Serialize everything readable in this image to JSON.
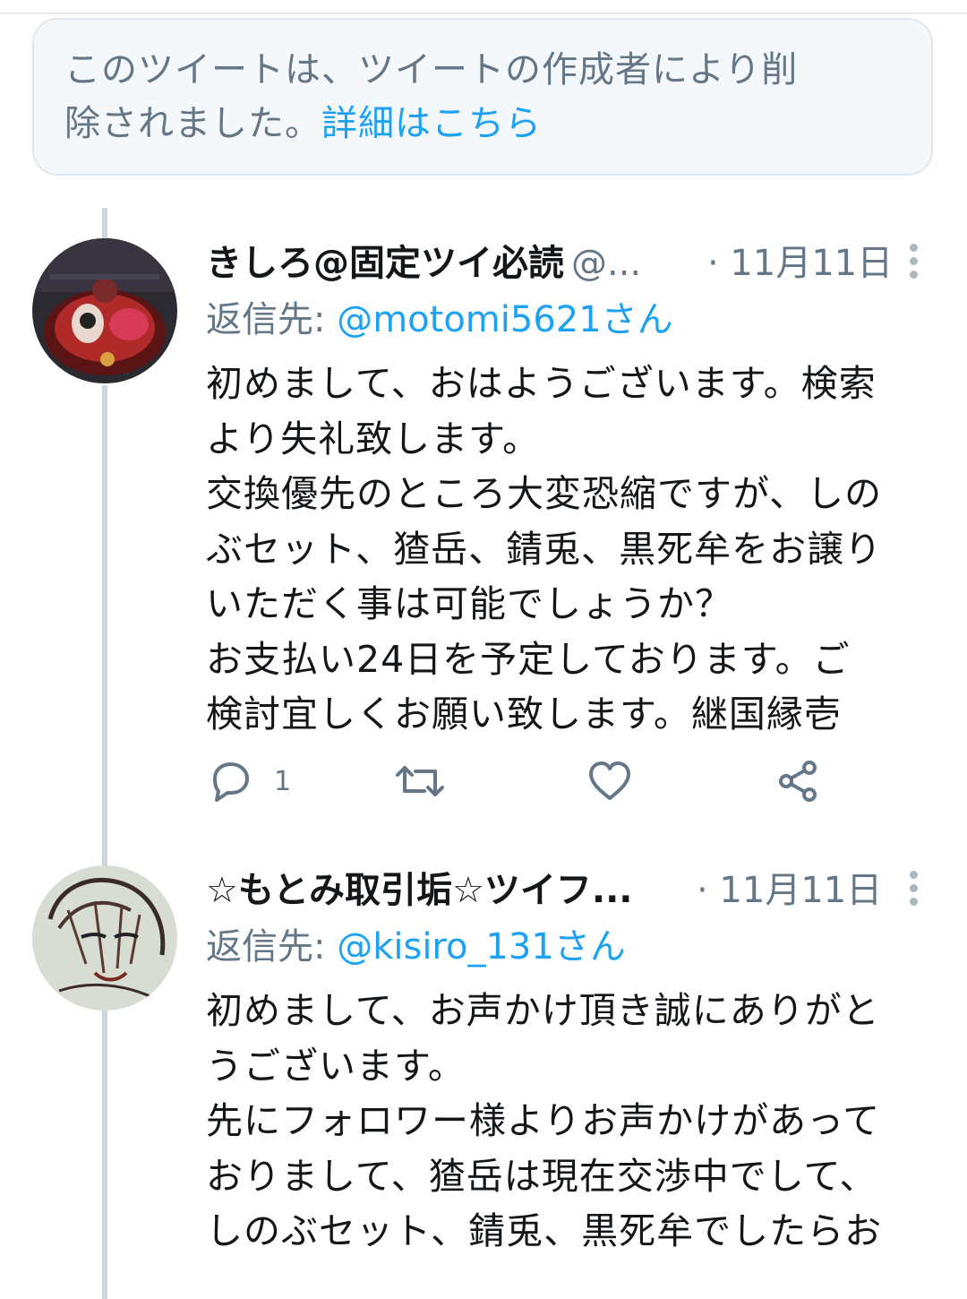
{
  "deleted_notice": {
    "line1": "このツイートは、ツイートの作成者により削",
    "line2": "除されました。",
    "link": "詳細はこちら"
  },
  "tweets": [
    {
      "display_name": "きしろ@固定ツイ必読",
      "handle": "@...",
      "time": "· 11月11日",
      "reply_prefix": "返信先: ",
      "reply_mention": "@motomi5621さん",
      "lines": [
        "初めまして、おはようございます。検索",
        "より失礼致します。",
        "交換優先のところ大変恐縮ですが、しの",
        "ぶセット、猹岳、錆兎、黒死牟をお譲り",
        "いただく事は可能でしょうか？",
        "お支払い24日を予定しております。ご",
        "検討宜しくお願い致します。継国縁壱"
      ],
      "reply_count": "1",
      "avatar_icon": "avatar-image-kishiro"
    },
    {
      "display_name": "☆もとみ取引垢☆ツイフ...",
      "handle": "",
      "time": "· 11月11日",
      "reply_prefix": "返信先: ",
      "reply_mention": "@kisiro_131さん",
      "lines": [
        "初めまして、お声かけ頂き誠にありがと",
        "うございます。",
        "先にフォロワー様よりお声かけがあって",
        "おりまして、猹岳は現在交渉中でして、",
        "しのぶセット、錆兎、黒死牟でしたらお"
      ],
      "avatar_icon": "avatar-image-motomi"
    }
  ],
  "icons": {
    "reply": "reply-icon",
    "retweet": "retweet-icon",
    "like": "heart-icon",
    "share": "share-icon",
    "more": "more-options-icon"
  },
  "colors": {
    "link": "#1da1f2",
    "secondary_text": "#657786",
    "primary_text": "#14171a",
    "thread_line": "#ccd6dd",
    "notice_bg": "#f5f8fa"
  }
}
